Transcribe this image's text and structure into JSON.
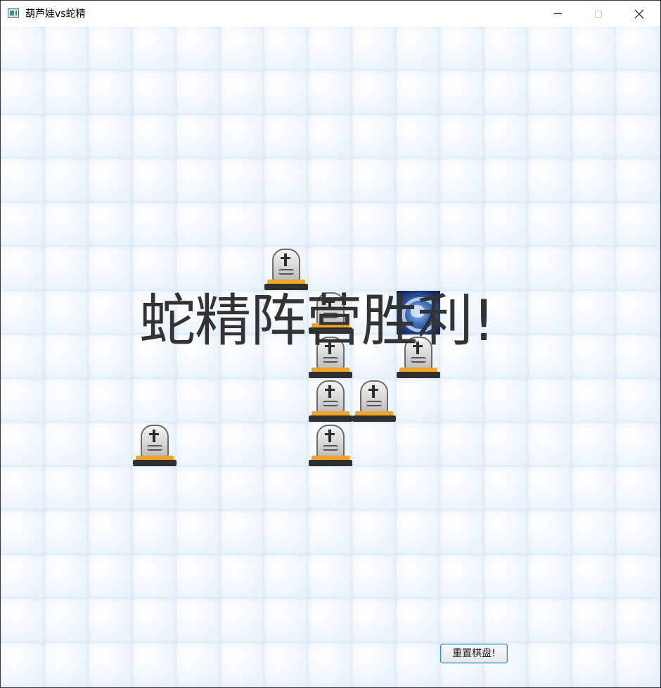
{
  "window": {
    "title": "葫芦娃vs蛇精",
    "icon": "app-window-icon",
    "controls": [
      "minimize-icon",
      "maximize-icon",
      "close-icon"
    ]
  },
  "board": {
    "rows": 15,
    "cols": 15,
    "pieces": [
      {
        "type": "tombstone",
        "row": 5,
        "col": 6
      },
      {
        "type": "tombstone",
        "row": 6,
        "col": 7
      },
      {
        "type": "snake-spirit",
        "row": 6,
        "col": 9
      },
      {
        "type": "tombstone",
        "row": 7,
        "col": 7
      },
      {
        "type": "tombstone",
        "row": 7,
        "col": 9
      },
      {
        "type": "tombstone",
        "row": 8,
        "col": 7
      },
      {
        "type": "tombstone",
        "row": 8,
        "col": 8
      },
      {
        "type": "tombstone",
        "row": 9,
        "col": 3
      },
      {
        "type": "tombstone",
        "row": 9,
        "col": 7
      }
    ]
  },
  "result": {
    "message": "蛇精阵营胜利!"
  },
  "controls": {
    "reset_label": "重置棋盘!"
  }
}
